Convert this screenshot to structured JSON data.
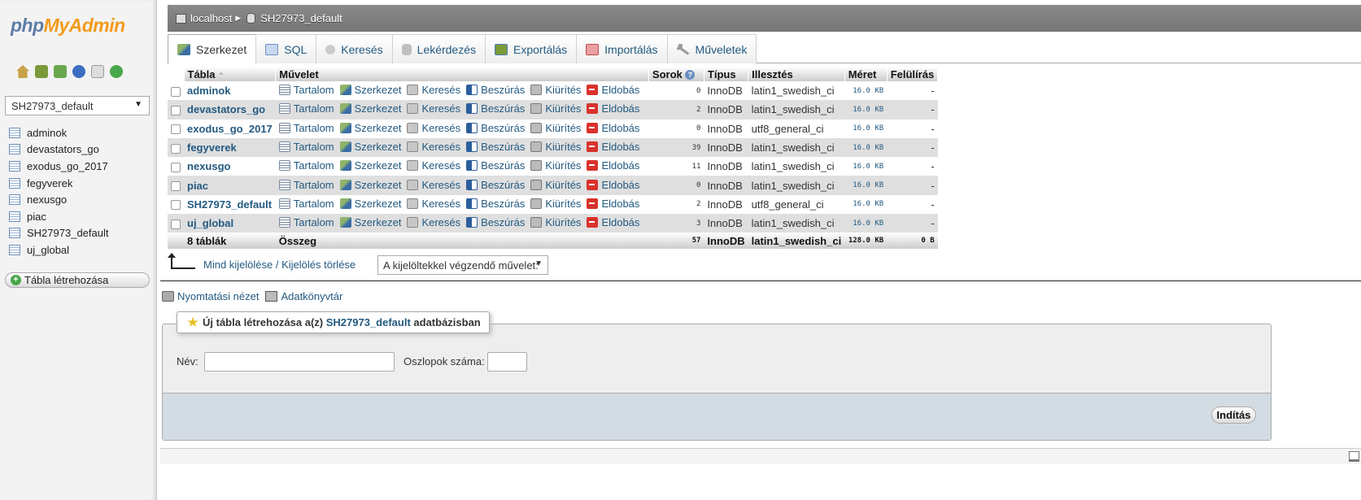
{
  "app": {
    "logo_part1": "php",
    "logo_part2": "MyAdmin"
  },
  "nav": {
    "icons": [
      "home-icon",
      "logout-icon",
      "query-window-icon",
      "docs-icon",
      "sql-docs-icon",
      "reload-icon"
    ],
    "db_select_value": "SH27973_default",
    "tables": [
      "adminok",
      "devastators_go",
      "exodus_go_2017",
      "fegyverek",
      "nexusgo",
      "piac",
      "SH27973_default",
      "uj_global"
    ],
    "new_table_label": "Tábla létrehozása"
  },
  "breadcrumb": {
    "server": "localhost",
    "database": "SH27973_default"
  },
  "tabs": [
    {
      "label": "Szerkezet",
      "icon": "structure-icon",
      "color": "#6a9a3a"
    },
    {
      "label": "SQL",
      "icon": "sql-icon",
      "color": "#6b8fc2"
    },
    {
      "label": "Keresés",
      "icon": "search-icon",
      "color": "#b8b8b8"
    },
    {
      "label": "Lekérdezés",
      "icon": "query-icon",
      "color": "#b0b0b0"
    },
    {
      "label": "Exportálás",
      "icon": "export-icon",
      "color": "#4f7cb3"
    },
    {
      "label": "Importálás",
      "icon": "import-icon",
      "color": "#c0504d"
    },
    {
      "label": "Műveletek",
      "icon": "operations-icon",
      "color": "#8a8a8a"
    }
  ],
  "table": {
    "headers": {
      "table": "Tábla",
      "sort": "⌃",
      "action": "Művelet",
      "rows": "Sorok",
      "type": "Típus",
      "collation": "Illesztés",
      "size": "Méret",
      "overhead": "Felülírás"
    },
    "actions": {
      "browse": "Tartalom",
      "structure": "Szerkezet",
      "search": "Keresés",
      "insert": "Beszúrás",
      "empty": "Kiürítés",
      "drop": "Eldobás"
    },
    "rows": [
      {
        "name": "adminok",
        "rows": "0",
        "type": "InnoDB",
        "collation": "latin1_swedish_ci",
        "size": "16.0 KB",
        "overhead": "-"
      },
      {
        "name": "devastators_go",
        "rows": "2",
        "type": "InnoDB",
        "collation": "latin1_swedish_ci",
        "size": "16.0 KB",
        "overhead": "-"
      },
      {
        "name": "exodus_go_2017",
        "rows": "0",
        "type": "InnoDB",
        "collation": "utf8_general_ci",
        "size": "16.0 KB",
        "overhead": "-"
      },
      {
        "name": "fegyverek",
        "rows": "39",
        "type": "InnoDB",
        "collation": "latin1_swedish_ci",
        "size": "16.0 KB",
        "overhead": "-"
      },
      {
        "name": "nexusgo",
        "rows": "11",
        "type": "InnoDB",
        "collation": "latin1_swedish_ci",
        "size": "16.0 KB",
        "overhead": "-"
      },
      {
        "name": "piac",
        "rows": "0",
        "type": "InnoDB",
        "collation": "latin1_swedish_ci",
        "size": "16.0 KB",
        "overhead": "-"
      },
      {
        "name": "SH27973_default",
        "rows": "2",
        "type": "InnoDB",
        "collation": "utf8_general_ci",
        "size": "16.0 KB",
        "overhead": "-"
      },
      {
        "name": "uj_global",
        "rows": "3",
        "type": "InnoDB",
        "collation": "latin1_swedish_ci",
        "size": "16.0 KB",
        "overhead": "-"
      }
    ],
    "total": {
      "label": "8 táblák",
      "action": "Összeg",
      "rows": "57",
      "type": "InnoDB",
      "collation": "latin1_swedish_ci",
      "size": "128.0 KB",
      "overhead": "0 B"
    }
  },
  "bulk": {
    "check_all": "Mind kijelölése",
    "separator": " / ",
    "uncheck_all": "Kijelölés törlése",
    "with_selected": "A kijelöltekkel végzendő művelet:"
  },
  "links": {
    "print_view": "Nyomtatási nézet",
    "data_dictionary": "Adatkönyvtár"
  },
  "create": {
    "legend_prefix": "Új tábla létrehozása a(z) ",
    "legend_db": "SH27973_default",
    "legend_suffix": " adatbázisban",
    "name_label": "Név:",
    "name_value": "",
    "cols_label": "Oszlopok száma:",
    "cols_value": "",
    "go": "Indítás"
  }
}
